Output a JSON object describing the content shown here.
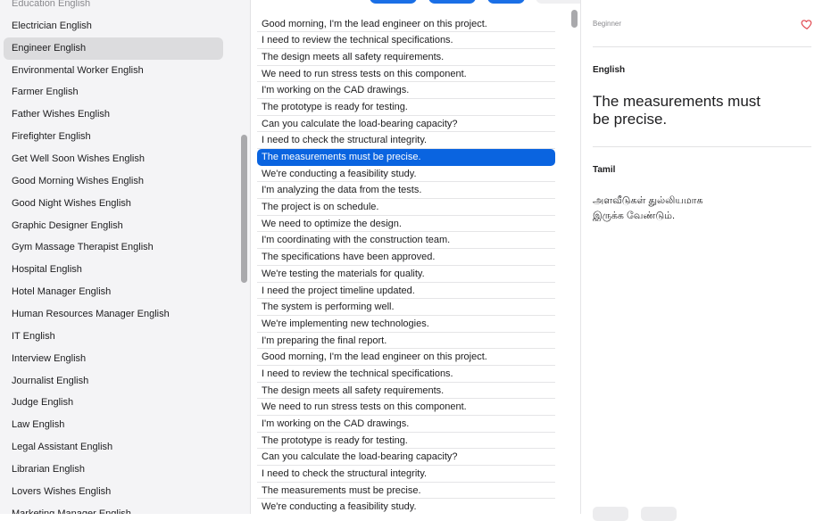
{
  "sidebar": {
    "items": [
      {
        "label": "Education English",
        "state": "partial"
      },
      {
        "label": "Electrician English"
      },
      {
        "label": "Engineer English",
        "state": "selected"
      },
      {
        "label": "Environmental Worker English"
      },
      {
        "label": "Farmer English"
      },
      {
        "label": "Father Wishes English"
      },
      {
        "label": "Firefighter English"
      },
      {
        "label": "Get Well Soon Wishes English"
      },
      {
        "label": "Good Morning Wishes English"
      },
      {
        "label": "Good Night Wishes English"
      },
      {
        "label": "Graphic Designer English"
      },
      {
        "label": "Gym Massage Therapist English"
      },
      {
        "label": "Hospital English"
      },
      {
        "label": "Hotel Manager English"
      },
      {
        "label": "Human Resources Manager English"
      },
      {
        "label": "IT English"
      },
      {
        "label": "Interview English"
      },
      {
        "label": "Journalist English"
      },
      {
        "label": "Judge English"
      },
      {
        "label": "Law English"
      },
      {
        "label": "Legal Assistant English"
      },
      {
        "label": "Librarian English"
      },
      {
        "label": "Lovers Wishes English"
      },
      {
        "label": "Marketing Manager English"
      }
    ]
  },
  "phrases": {
    "selected_index": 8,
    "items": [
      "Good morning, I'm the lead engineer on this project.",
      "I need to review the technical specifications.",
      "The design meets all safety requirements.",
      "We need to run stress tests on this component.",
      "I'm working on the CAD drawings.",
      "The prototype is ready for testing.",
      "Can you calculate the load-bearing capacity?",
      "I need to check the structural integrity.",
      "The measurements must be precise.",
      "We're conducting a feasibility study.",
      "I'm analyzing the data from the tests.",
      "The project is on schedule.",
      "We need to optimize the design.",
      "I'm coordinating with the construction team.",
      "The specifications have been approved.",
      "We're testing the materials for quality.",
      "I need the project timeline updated.",
      "The system is performing well.",
      "We're implementing new technologies.",
      "I'm preparing the final report.",
      "Good morning, I'm the lead engineer on this project.",
      "I need to review the technical specifications.",
      "The design meets all safety requirements.",
      "We need to run stress tests on this component.",
      "I'm working on the CAD drawings.",
      "The prototype is ready for testing.",
      "Can you calculate the load-bearing capacity?",
      "I need to check the structural integrity.",
      "The measurements must be precise.",
      "We're conducting a feasibility study."
    ]
  },
  "detail": {
    "level": "Beginner",
    "favorite_icon": "heart-outline-icon",
    "english_label": "English",
    "english_text": "The measurements must be precise.",
    "tamil_label": "Tamil",
    "tamil_text": "அளவீடுகள் துல்லியமாக இருக்க வேண்டும்."
  },
  "colors": {
    "accent": "#0a64e0",
    "heart": "#e0434b",
    "sidebar_bg": "#f4f4f6",
    "selected_sidebar": "#dcdcde"
  }
}
